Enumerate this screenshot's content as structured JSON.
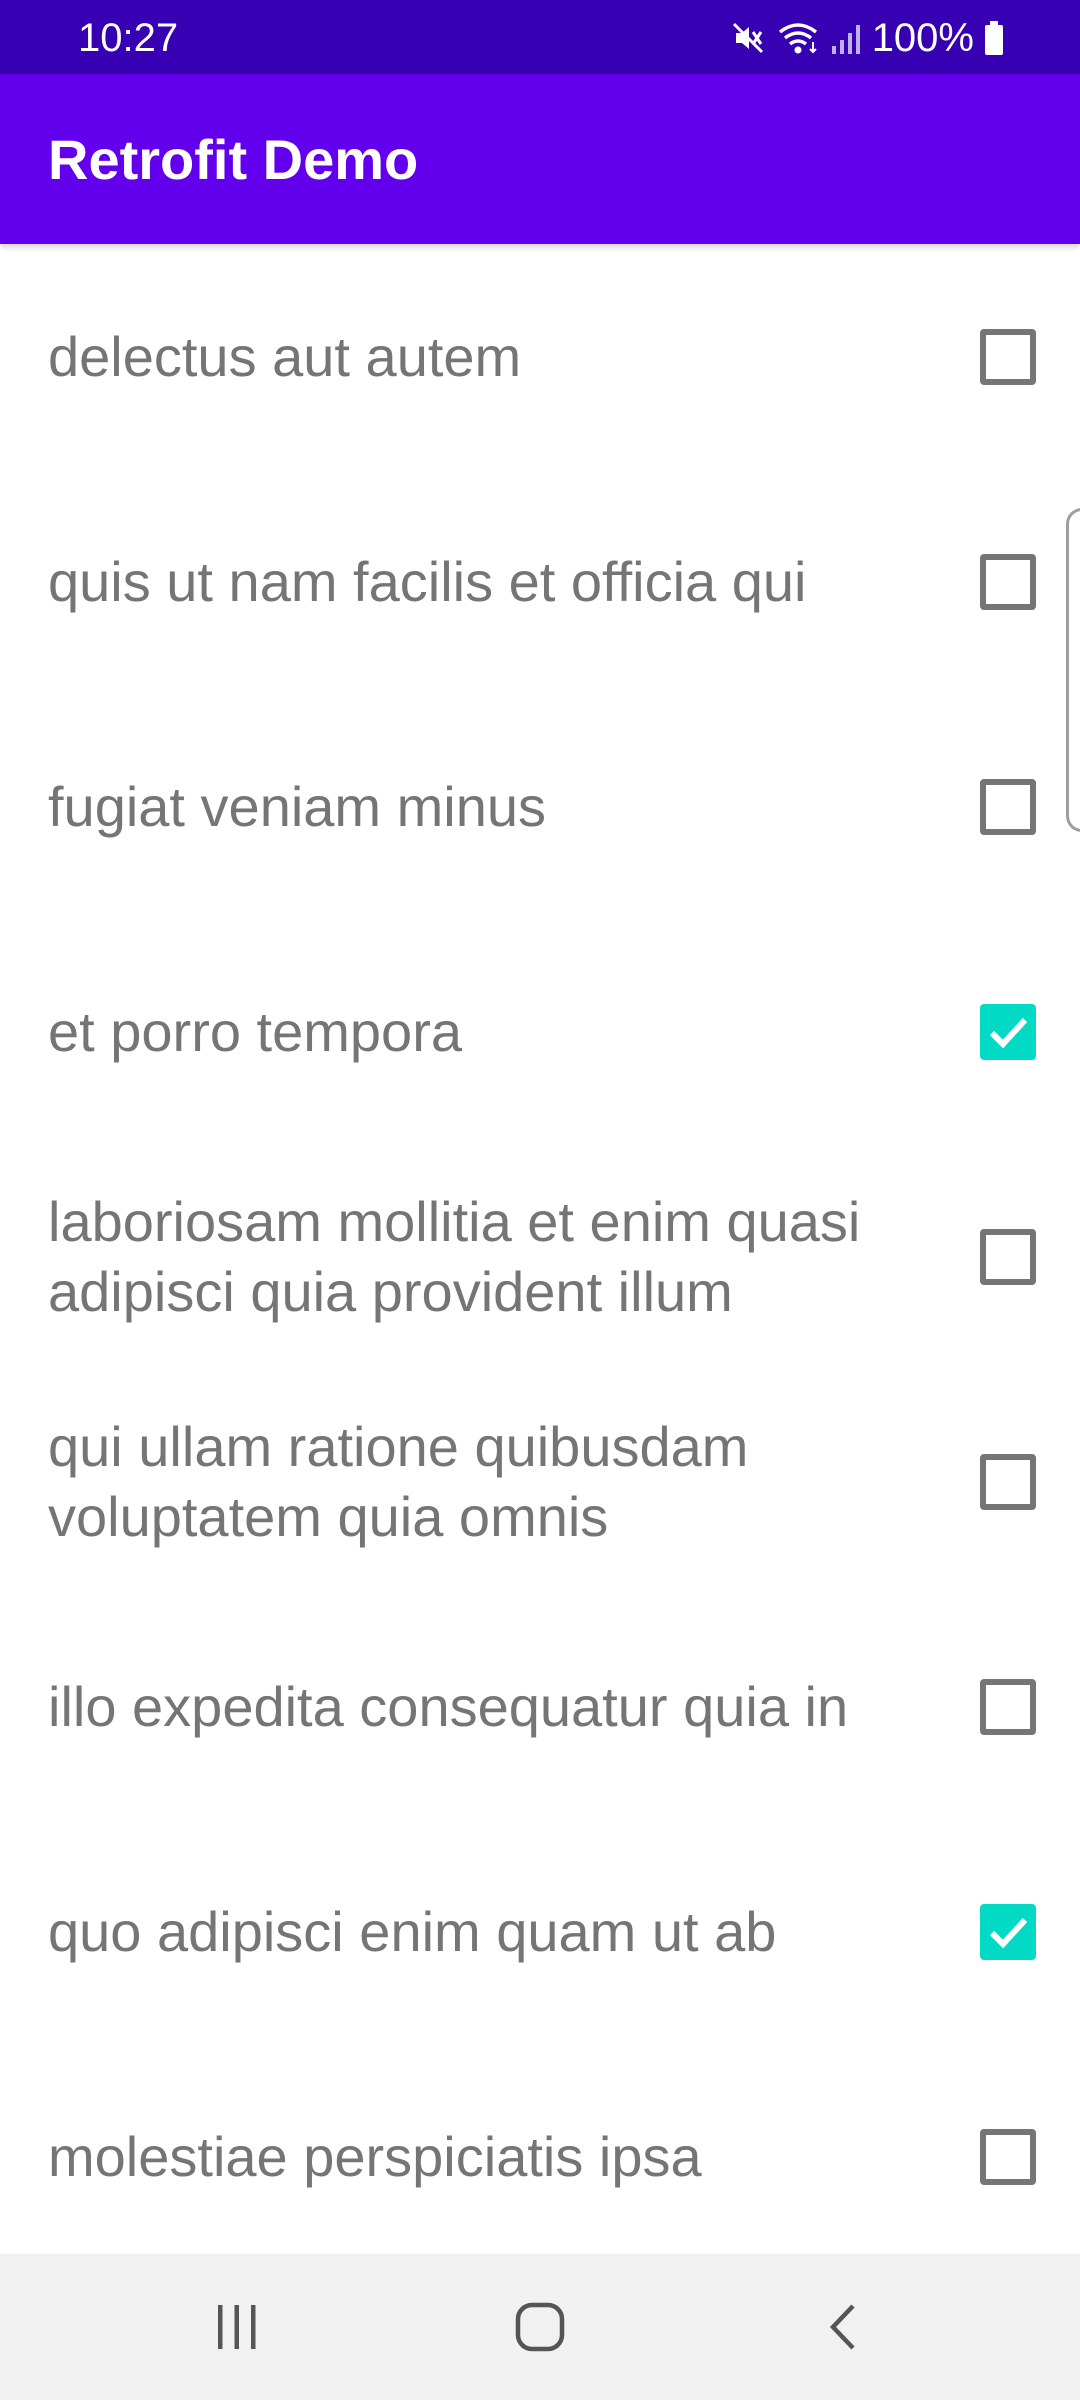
{
  "status_bar": {
    "time": "10:27",
    "battery": "100%",
    "icons": [
      "mute-icon",
      "wifi-icon",
      "signal-icon",
      "battery-icon"
    ]
  },
  "app_bar": {
    "title": "Retrofit Demo",
    "color": "#6200ee",
    "status_color": "#3700b3"
  },
  "colors": {
    "checkbox_checked": "#03dac5",
    "checkbox_unchecked": "#757575",
    "text": "#757575"
  },
  "todos": [
    {
      "title": "delectus aut autem",
      "completed": false
    },
    {
      "title": "quis ut nam facilis et officia qui",
      "completed": false
    },
    {
      "title": "fugiat veniam minus",
      "completed": false
    },
    {
      "title": "et porro tempora",
      "completed": true
    },
    {
      "title": "laboriosam mollitia et enim quasi adipisci quia provident illum",
      "completed": false
    },
    {
      "title": "qui ullam ratione quibusdam voluptatem quia omnis",
      "completed": false
    },
    {
      "title": "illo expedita consequatur quia in",
      "completed": false
    },
    {
      "title": "quo adipisci enim quam ut ab",
      "completed": true
    },
    {
      "title": "molestiae perspiciatis ipsa",
      "completed": false
    }
  ],
  "nav_bar": {
    "buttons": [
      "recent-apps-icon",
      "home-icon",
      "back-icon"
    ]
  }
}
